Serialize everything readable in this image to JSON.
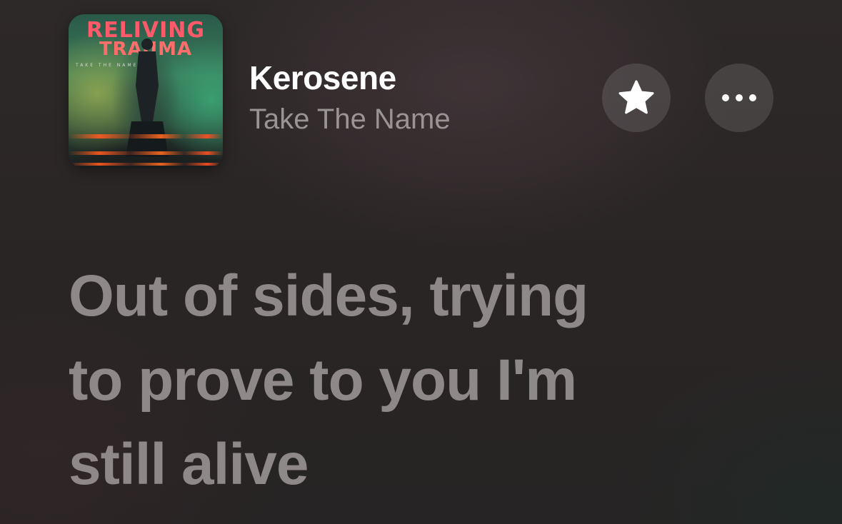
{
  "now_playing": {
    "song_title": "Kerosene",
    "artist": "Take The Name",
    "artwork": {
      "title_line1": "RELIVING",
      "title_line2": "TRAUMA",
      "subtitle": "TAKE THE NAME"
    }
  },
  "actions": {
    "favorite_icon": "star-icon",
    "more_icon": "ellipsis-icon"
  },
  "lyrics": {
    "lines": [
      "Out of sides, trying",
      "to prove to you I'm",
      "still alive"
    ]
  },
  "colors": {
    "background": "#2a2525",
    "title": "#ffffff",
    "artist": "#9a9494",
    "lyric_text": "#8e8888",
    "button_fill": "rgba(255,255,255,0.12)"
  }
}
